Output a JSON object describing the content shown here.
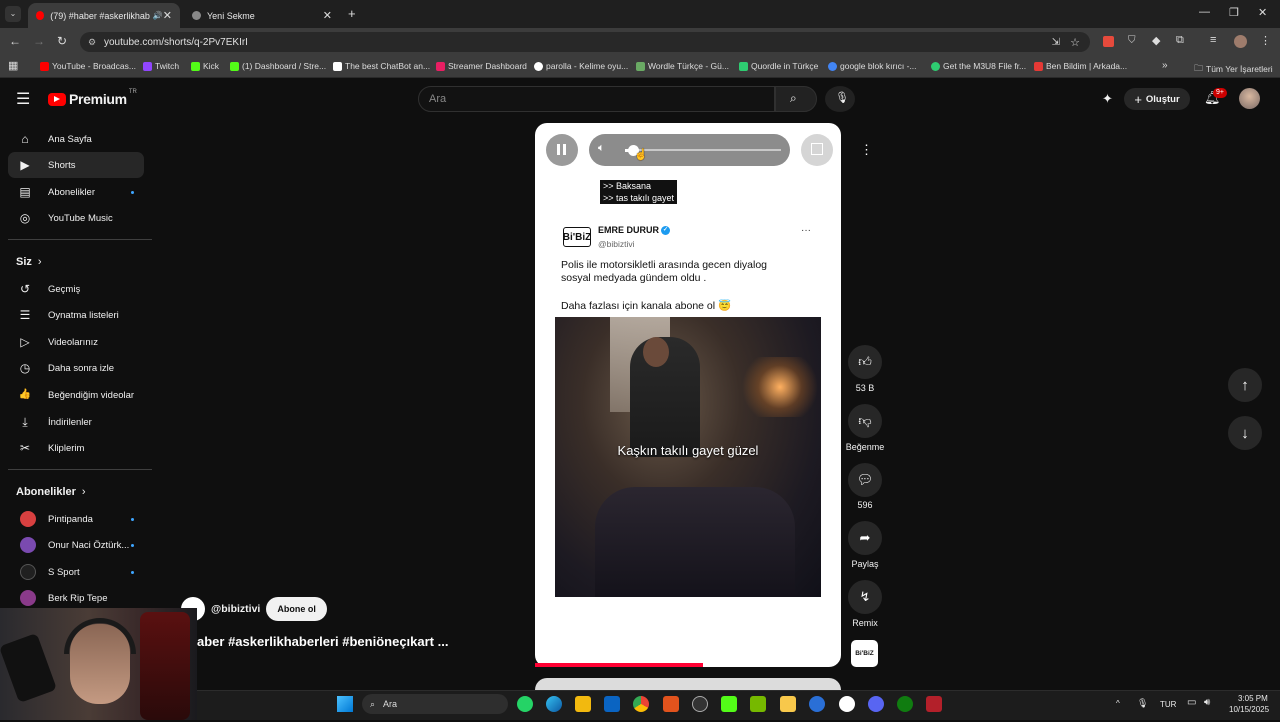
{
  "browser": {
    "tabs": [
      {
        "title": "(79) #haber #askerlikhaberl",
        "active": true
      },
      {
        "title": "Yeni Sekme",
        "active": false
      }
    ],
    "url": "youtube.com/shorts/q-2Pv7EKIrI",
    "bookmarks": [
      {
        "label": "YouTube - Broadcas...",
        "color": "#ff0000"
      },
      {
        "label": "Twitch",
        "color": "#9146ff"
      },
      {
        "label": "Kick",
        "color": "#53fc18"
      },
      {
        "label": "(1) Dashboard / Stre...",
        "color": "#53fc18"
      },
      {
        "label": "The best ChatBot an...",
        "color": "#ffffff"
      },
      {
        "label": "Streamer Dashboard",
        "color": "#e91e63"
      },
      {
        "label": "parolla - Kelime oyu...",
        "color": "#ffffff"
      },
      {
        "label": "Wordle Türkçe - Gü...",
        "color": "#6aaa64"
      },
      {
        "label": "Quordle in Türkçe",
        "color": "#2ecc71"
      },
      {
        "label": "google blok kırıcı -...",
        "color": "#4285f4"
      },
      {
        "label": "Get the M3U8 File fr...",
        "color": "#2ecc71"
      },
      {
        "label": "Ben Bildim | Arkada...",
        "color": "#e53935"
      }
    ],
    "all_bookmarks": "Tüm Yer İşaretleri"
  },
  "youtube": {
    "logo": "Premium",
    "region": "TR",
    "search_placeholder": "Ara",
    "create_label": "Oluştur",
    "notif_count": "9+"
  },
  "sidebar": {
    "main": [
      {
        "label": "Ana Sayfa",
        "icon": "home-icon",
        "glyph": "⌂"
      },
      {
        "label": "Shorts",
        "icon": "shorts-icon",
        "glyph": "▶",
        "active": true
      },
      {
        "label": "Abonelikler",
        "icon": "subscriptions-icon",
        "glyph": "▤",
        "dot": true
      },
      {
        "label": "YouTube Music",
        "icon": "music-icon",
        "glyph": "◎"
      }
    ],
    "you_heading": "Siz",
    "you": [
      {
        "label": "Geçmiş",
        "icon": "history-icon",
        "glyph": "↺"
      },
      {
        "label": "Oynatma listeleri",
        "icon": "playlists-icon",
        "glyph": "☰"
      },
      {
        "label": "Videolarınız",
        "icon": "your-videos-icon",
        "glyph": "▷"
      },
      {
        "label": "Daha sonra izle",
        "icon": "watch-later-icon",
        "glyph": "◷"
      },
      {
        "label": "Beğendiğim videolar",
        "icon": "liked-icon",
        "glyph": "👍"
      },
      {
        "label": "İndirilenler",
        "icon": "downloads-icon",
        "glyph": "⤓"
      },
      {
        "label": "Kliplerim",
        "icon": "clips-icon",
        "glyph": "✂"
      }
    ],
    "subs_heading": "Abonelikler",
    "subs": [
      {
        "label": "Pintipanda",
        "color": "#d84040",
        "dot": true
      },
      {
        "label": "Onur Naci Öztürk...",
        "color": "#7a4ab0",
        "dot": true
      },
      {
        "label": "S Sport",
        "color": "#202020",
        "dot": true
      },
      {
        "label": "Berk Rip Tepe",
        "color": "#8a3a8a",
        "dot": false
      }
    ]
  },
  "short": {
    "caption_lines": [
      ">> Baksana",
      ">> tas takılı gayet"
    ],
    "author_logo": "Bi'BiZ",
    "author_name": "EMRE DURUR",
    "author_handle": "@bibiztivi",
    "post_line1": "Polis ile motorsikletli arasında gecen diyalog",
    "post_line2": "sosyal medyada gündem oldu .",
    "post_line3": "Daha fazlası için kanala abone ol 😇",
    "video_subtitle": "Kaşkın takılı gayet güzel",
    "progress": 0.55,
    "volume": 0.06,
    "channel_handle": "@bibiztivi",
    "subscribe_label": "Abone ol",
    "title": "aber #askerlikhaberleri #beniöneçıkart ..."
  },
  "actions": {
    "like_count": "53 B",
    "dislike_label": "Beğenme",
    "comment_count": "596",
    "share_label": "Paylaş",
    "remix_label": "Remix",
    "sound_logo": "Bi'BiZ"
  },
  "taskbar": {
    "search_placeholder": "Ara",
    "lang": "TUR",
    "time": "3:05 PM",
    "date": "10/15/2025"
  }
}
